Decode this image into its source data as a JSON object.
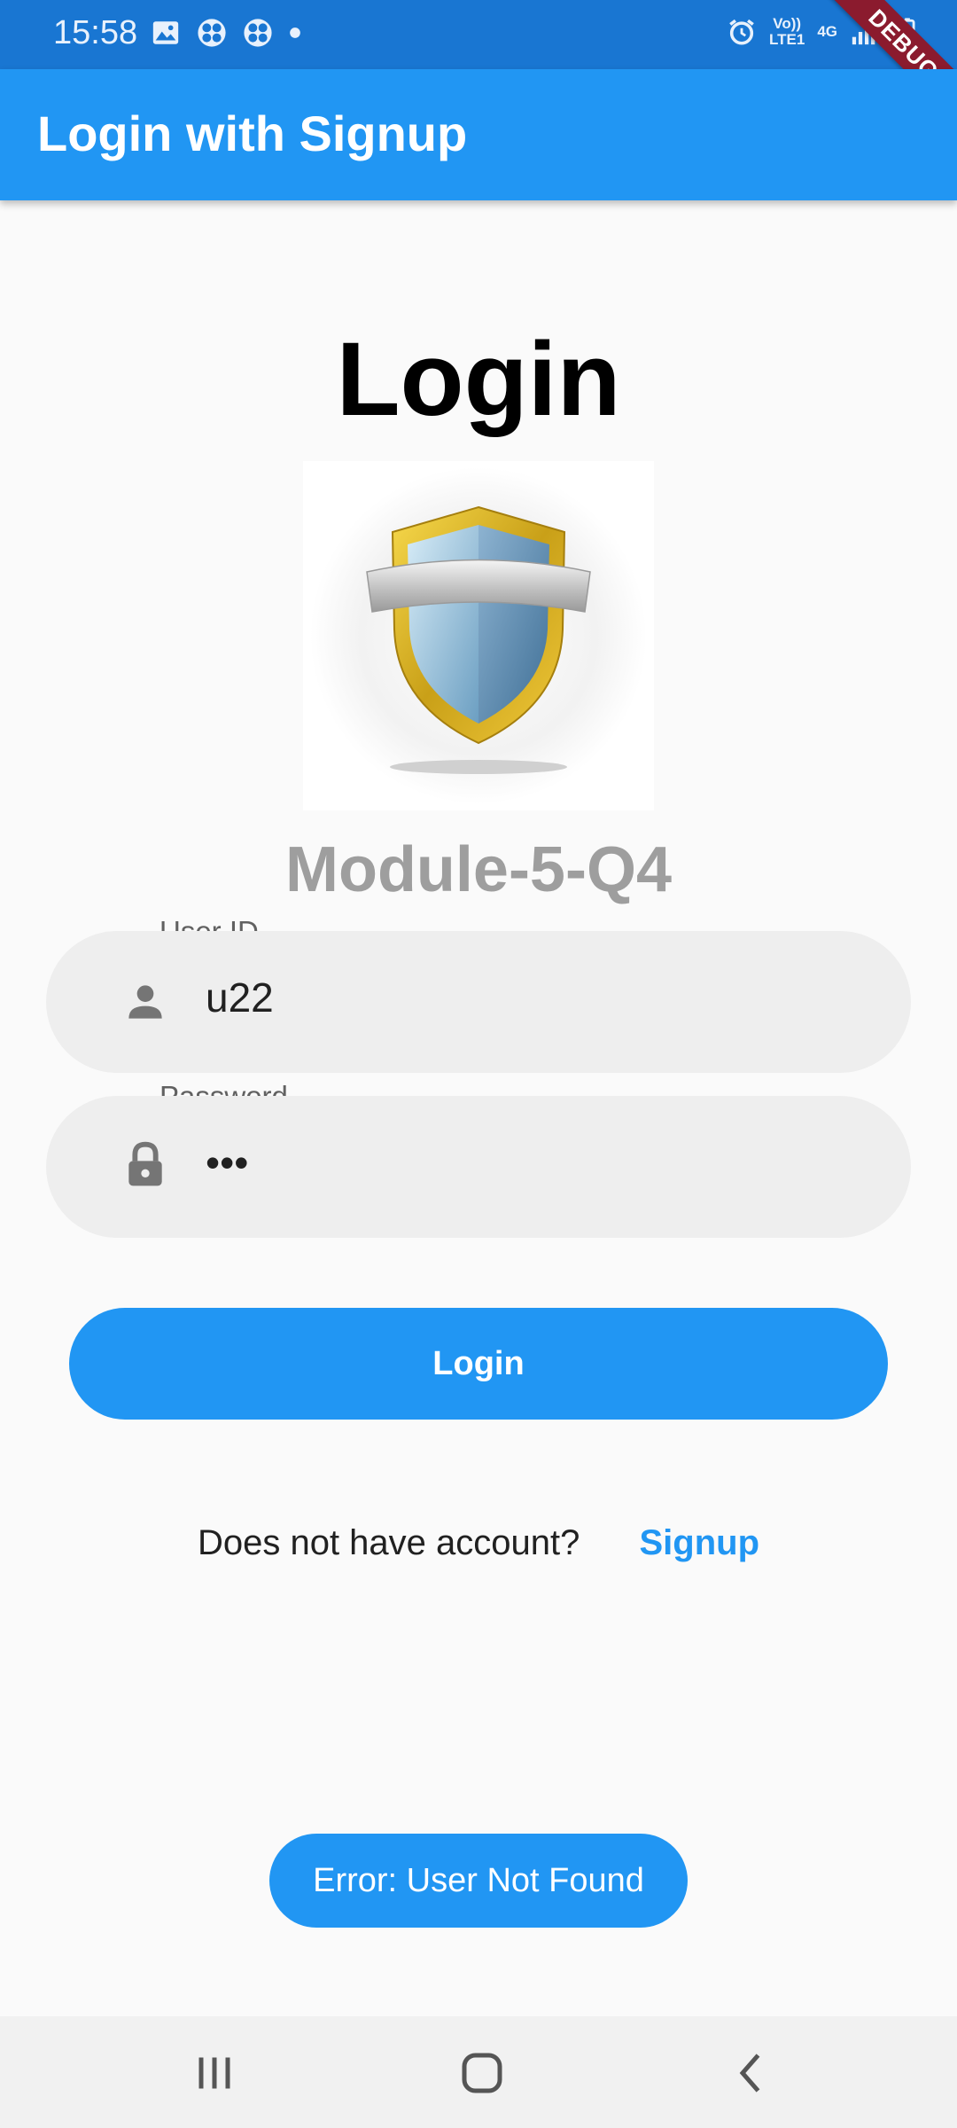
{
  "status_bar": {
    "time": "15:58",
    "network_top": "Vo))",
    "network_bottom": "LTE1",
    "network_type": "4G",
    "icons": [
      "image-icon",
      "pinwheel-icon",
      "pinwheel-icon",
      "dot-icon",
      "alarm-icon",
      "signal-icon",
      "battery-icon"
    ]
  },
  "debug_banner": "DEBUG",
  "app_bar": {
    "title": "Login with Signup"
  },
  "main": {
    "heading": "Login",
    "logo_icon": "shield-icon",
    "subtitle": "Module-5-Q4",
    "user_field": {
      "label": "User ID",
      "value": "u22",
      "icon": "person-icon"
    },
    "password_field": {
      "label": "Password",
      "value": "•••",
      "icon": "lock-icon"
    },
    "login_button": "Login",
    "signup_prompt": "Does not have account?",
    "signup_link": "Signup"
  },
  "toast": {
    "message": "Error: User Not Found"
  },
  "nav_bar": {
    "icons": [
      "recent-apps-icon",
      "home-icon",
      "back-icon"
    ]
  },
  "colors": {
    "primary": "#2196f3",
    "status_bar": "#1976d2",
    "subtitle": "#9e9e9e",
    "field_bg": "#eeeeee"
  }
}
